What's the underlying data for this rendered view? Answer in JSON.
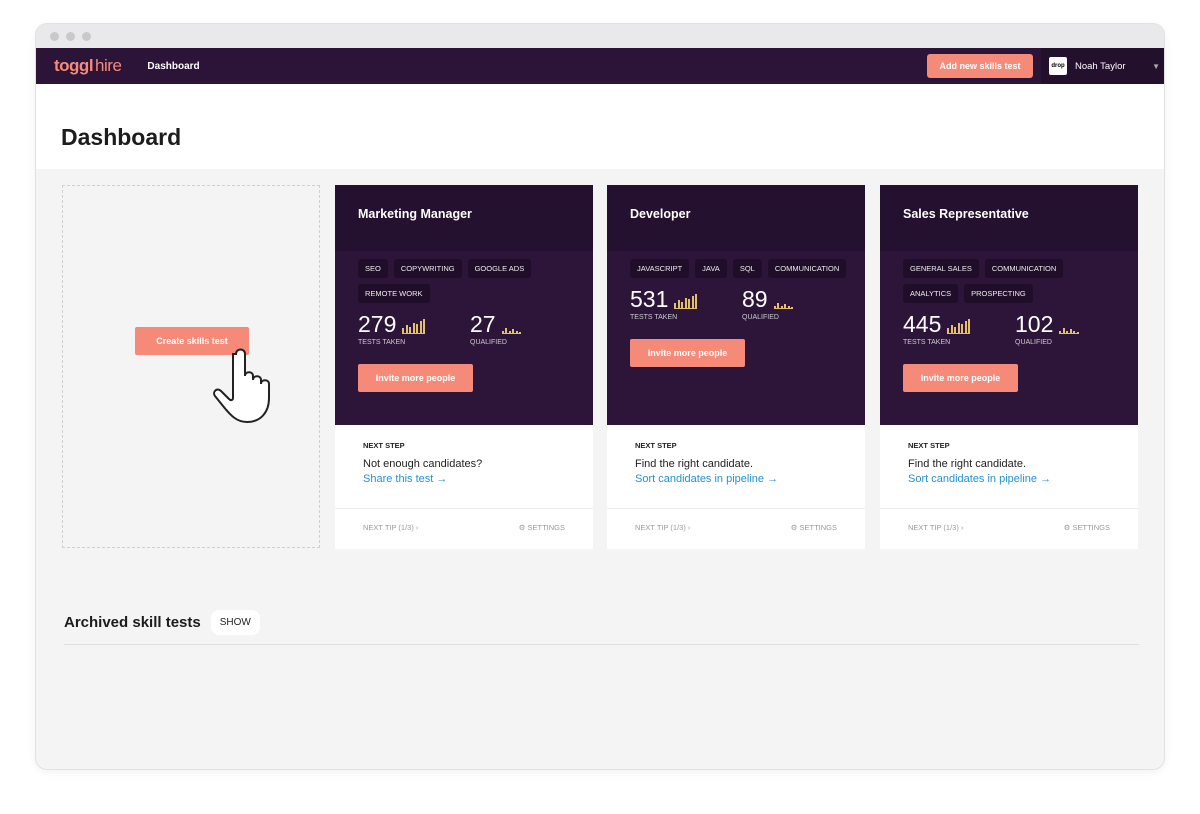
{
  "nav": {
    "logo_main": "toggl",
    "logo_sub": "hire",
    "dashboard": "Dashboard",
    "add_button": "Add new skills test",
    "user_name": "Noah Taylor",
    "avatar_text": "drop"
  },
  "page": {
    "title": "Dashboard"
  },
  "create": {
    "button": "Create skills test"
  },
  "cards": [
    {
      "title": "Marketing Manager",
      "tags": [
        "SEO",
        "COPYWRITING",
        "GOOGLE ADS",
        "REMOTE WORK"
      ],
      "tests_taken": "279",
      "tests_label": "TESTS TAKEN",
      "qualified": "27",
      "qualified_label": "QUALIFIED",
      "invite": "Invite more people",
      "next_step": "NEXT STEP",
      "next_desc": "Not enough candidates?",
      "next_link": "Share this test →",
      "tip": "NEXT TIP (1/3) ›",
      "settings": "SETTINGS"
    },
    {
      "title": "Developer",
      "tags": [
        "JAVASCRIPT",
        "JAVA",
        "SQL",
        "COMMUNICATION"
      ],
      "tests_taken": "531",
      "tests_label": "TESTS TAKEN",
      "qualified": "89",
      "qualified_label": "QUALIFIED",
      "invite": "Invite more people",
      "next_step": "NEXT STEP",
      "next_desc": "Find the right candidate.",
      "next_link": "Sort candidates in pipeline →",
      "tip": "NEXT TIP (1/3) ›",
      "settings": "SETTINGS"
    },
    {
      "title": "Sales Representative",
      "tags": [
        "GENERAL SALES",
        "COMMUNICATION",
        "ANALYTICS",
        "PROSPECTING"
      ],
      "tests_taken": "445",
      "tests_label": "TESTS TAKEN",
      "qualified": "102",
      "qualified_label": "QUALIFIED",
      "invite": "Invite more people",
      "next_step": "NEXT STEP",
      "next_desc": "Find the right candidate.",
      "next_link": "Sort candidates in pipeline →",
      "tip": "NEXT TIP (1/3) ›",
      "settings": "SETTINGS"
    }
  ],
  "archived": {
    "title": "Archived skill tests",
    "show": "SHOW"
  },
  "colors": {
    "nav": "#2c1338",
    "accent": "#f68a79",
    "link": "#2591d0"
  }
}
